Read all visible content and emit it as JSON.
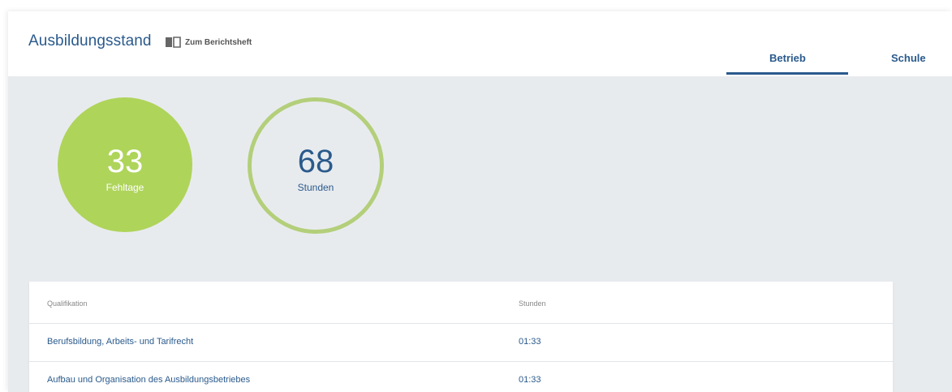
{
  "header": {
    "title": "Ausbildungsstand",
    "report_link_label": "Zum Berichtsheft",
    "tabs": [
      {
        "label": "Betrieb",
        "active": true
      },
      {
        "label": "Schule",
        "active": false
      }
    ]
  },
  "stats": {
    "fehltage": {
      "value": "33",
      "label": "Fehltage"
    },
    "stunden": {
      "value": "68",
      "label": "Stunden"
    }
  },
  "table": {
    "columns": [
      "Qualifikation",
      "Stunden"
    ],
    "rows": [
      {
        "qualifikation": "Berufsbildung, Arbeits- und Tarifrecht",
        "stunden": "01:33"
      },
      {
        "qualifikation": "Aufbau und Organisation des Ausbildungsbetriebes",
        "stunden": "01:33"
      }
    ]
  },
  "colors": {
    "accent": "#2a5a8c",
    "green": "#aed45a",
    "background": "#e8ebee"
  },
  "icons": {
    "report_link": "book-icon"
  }
}
